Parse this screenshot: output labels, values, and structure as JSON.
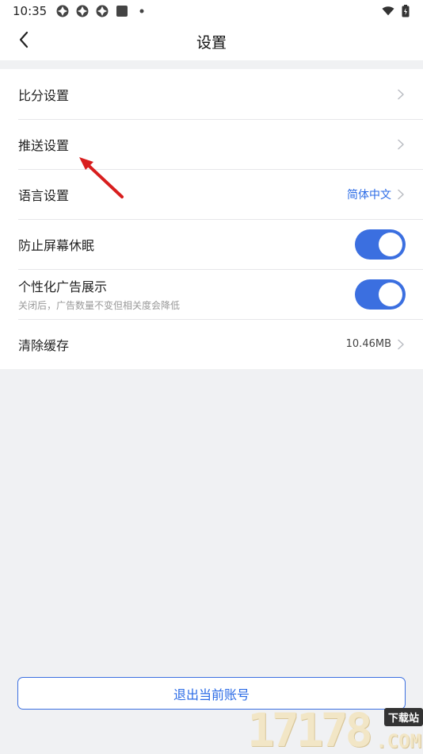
{
  "status_bar": {
    "time": "10:35",
    "left_icons": [
      "app-notification-icon",
      "app-notification-icon",
      "app-notification-icon",
      "square-app-icon",
      "dot-icon"
    ],
    "right_icons": [
      "wifi-icon",
      "battery-icon"
    ]
  },
  "header": {
    "title": "设置",
    "back_icon": "chevron-left-icon"
  },
  "settings": {
    "score": {
      "label": "比分设置"
    },
    "push": {
      "label": "推送设置"
    },
    "language": {
      "label": "语言设置",
      "value": "简体中文"
    },
    "screen_sleep": {
      "label": "防止屏幕休眠",
      "enabled": true
    },
    "personalized_ads": {
      "label": "个性化广告展示",
      "sub": "关闭后，广告数量不变但相关度会降低",
      "enabled": true
    },
    "clear_cache": {
      "label": "清除缓存",
      "value": "10.46MB"
    }
  },
  "logout": {
    "label": "退出当前账号"
  },
  "watermark": {
    "number": "17178",
    "tag": "下载站",
    "domain": ".COM"
  },
  "colors": {
    "accent": "#3b6fe0",
    "link": "#2b6be6",
    "background": "#f0f1f3",
    "annotation_arrow": "#d81e1e"
  }
}
